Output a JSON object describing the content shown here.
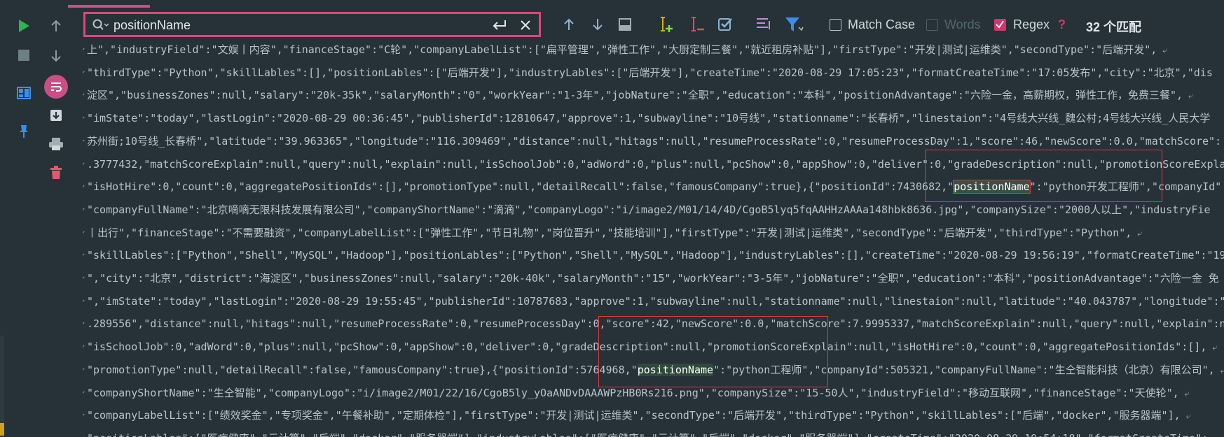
{
  "search": {
    "query": "positionName",
    "match_case_label": "Match Case",
    "words_label": "Words",
    "regex_label": "Regex",
    "regex_help": "?",
    "match_count": "32 个匹配",
    "match_case_checked": false,
    "words_checked": false,
    "regex_checked": true
  },
  "colors": {
    "background": "#263238",
    "search_border": "#e0457b",
    "highlight_box": "#e03a3a",
    "run_icon": "#2fb34f",
    "delete_icon": "#e05a6c",
    "filter_icon": "#3b8eea",
    "add_icon": "#7ddc4d",
    "remove_icon": "#e84a5f"
  },
  "left_toolbar": {
    "icons": [
      "run-icon",
      "stop-icon",
      "layout-icon",
      "pin-icon",
      "up-icon",
      "down-icon",
      "soft-wrap-icon",
      "import-icon",
      "print-icon",
      "delete-icon"
    ]
  },
  "code_lines": [
    "上\",\"industryField\":\"文娱丨内容\",\"financeStage\":\"C轮\",\"companyLabelList\":[\"扁平管理\",\"弹性工作\",\"大厨定制三餐\",\"就近租房补贴\"],\"firstType\":\"开发|测试|运维类\",\"secondType\":\"后端开发\",",
    "\"thirdType\":\"Python\",\"skillLables\":[],\"positionLables\":[\"后端开发\"],\"industryLables\":[\"后端开发\"],\"createTime\":\"2020-08-29 17:05:23\",\"formatCreateTime\":\"17:05发布\",\"city\":\"北京\",\"dis",
    "淀区\",\"businessZones\":null,\"salary\":\"20k-35k\",\"salaryMonth\":\"0\",\"workYear\":\"1-3年\",\"jobNature\":\"全职\",\"education\":\"本科\",\"positionAdvantage\":\"六险一金，高薪期权，弹性工作，免费三餐\",",
    "\"imState\":\"today\",\"lastLogin\":\"2020-08-29 00:36:45\",\"publisherId\":12810647,\"approve\":1,\"subwayline\":\"10号线\",\"stationname\":\"长春桥\",\"linestaion\":\"4号线大兴线_魏公村;4号线大兴线_人民大学",
    "苏州街;10号线_长春桥\",\"latitude\":\"39.963365\",\"longitude\":\"116.309469\",\"distance\":null,\"hitags\":null,\"resumeProcessRate\":0,\"resumeProcessDay\":1,\"score\":46,\"newScore\":0.0,\"matchScore\":",
    ".3777432,\"matchScoreExplain\":null,\"query\":null,\"explain\":null,\"isSchoolJob\":0,\"adWord\":0,\"plus\":null,\"pcShow\":0,\"appShow\":0,\"deliver\":0,\"gradeDescription\":null,\"promotionScoreExpla",
    "\"isHotHire\":0,\"count\":0,\"aggregatePositionIds\":[],\"promotionType\":null,\"detailRecall\":false,\"famousCompany\":true},{\"positionId\":7430682,\"positionName\":\"python开发工程师\",\"companyId\"",
    "\"companyFullName\":\"北京嘀嘀无限科技发展有限公司\",\"companyShortName\":\"滴滴\",\"companyLogo\":\"i/image2/M01/14/4D/CgoB5lyq5fqAAHHzAAAa148hbk8636.jpg\",\"companySize\":\"2000人以上\",\"industryFie",
    "丨出行\",\"financeStage\":\"不需要融资\",\"companyLabelList\":[\"弹性工作\",\"节日礼物\",\"岗位晋升\",\"技能培训\"],\"firstType\":\"开发|测试|运维类\",\"secondType\":\"后端开发\",\"thirdType\":\"Python\",",
    "\"skillLables\":[\"Python\",\"Shell\",\"MySQL\",\"Hadoop\"],\"positionLables\":[\"Python\",\"Shell\",\"MySQL\",\"Hadoop\"],\"industryLables\":[],\"createTime\":\"2020-08-29 19:56:19\",\"formatCreateTime\":\"19",
    "\",\"city\":\"北京\",\"district\":\"海淀区\",\"businessZones\":null,\"salary\":\"20k-40k\",\"salaryMonth\":\"15\",\"workYear\":\"3-5年\",\"jobNature\":\"全职\",\"education\":\"本科\",\"positionAdvantage\":\"六险一金 免",
    "\",\"imState\":\"today\",\"lastLogin\":\"2020-08-29 19:55:45\",\"publisherId\":10787683,\"approve\":1,\"subwayline\":null,\"stationname\":null,\"linestaion\":null,\"latitude\":\"40.043787\",\"longitude\":\"",
    ".289556\",\"distance\":null,\"hitags\":null,\"resumeProcessRate\":0,\"resumeProcessDay\":0,\"score\":42,\"newScore\":0.0,\"matchScore\":7.9995337,\"matchScoreExplain\":null,\"query\":null,\"explain\":n",
    "\"isSchoolJob\":0,\"adWord\":0,\"plus\":null,\"pcShow\":0,\"appShow\":0,\"deliver\":0,\"gradeDescription\":null,\"promotionScoreExplain\":null,\"isHotHire\":0,\"count\":0,\"aggregatePositionIds\":[],",
    "\"promotionType\":null,\"detailRecall\":false,\"famousCompany\":true},{\"positionId\":5764968,\"positionName\":\"python工程师\",\"companyId\":505321,\"companyFullName\":\"生仝智能科技（北京）有限公司\",",
    "\"companyShortName\":\"生仝智能\",\"companyLogo\":\"i/image2/M01/22/16/CgoB5ly_yOaANDvDAAAWPzHB0Rs216.png\",\"companySize\":\"15-50人\",\"industryField\":\"移动互联网\",\"financeStage\":\"天使轮\",",
    "\"companyLabelList\":[\"绩效奖金\",\"专项奖金\",\"午餐补助\",\"定期体检\"],\"firstType\":\"开发|测试|运维类\",\"secondType\":\"后端开发\",\"thirdType\":\"Python\",\"skillLables\":[\"后端\",\"docker\",\"服务器端\"],",
    "\"positionLables\":[\"医疗健康\",\"云计算\",\"后端\",\"docker\",\"服务器端\"],\"industryLables\":[\"医疗健康\",\"云计算\",\"后端\",\"docker\",\"服务器端\"],\"createTime\":\"2020-08-29 19:54:18\",\"formatCreateTime\":"
  ]
}
